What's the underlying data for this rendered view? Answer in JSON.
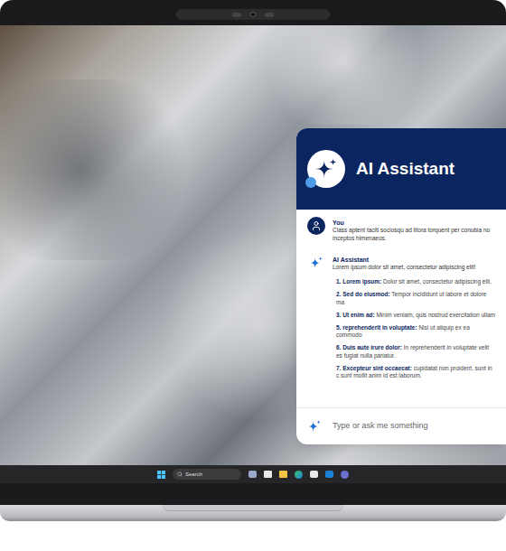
{
  "assistant": {
    "title": "AI Assistant",
    "input_placeholder": "Type or ask me something"
  },
  "messages": [
    {
      "kind": "user",
      "author": "You",
      "text": "Class aptent taciti sociosqu ad litora torquent per conubia no inceptos himenaeos."
    },
    {
      "kind": "assistant",
      "author": "AI Assistant",
      "text": "Lorem ipsum dolor sit amet, consectetur adipiscing elit!",
      "items": [
        {
          "number": "1.",
          "term": "Lorem ipsum:",
          "text": "Dolor sit amet, consectetur adipiscing elit."
        },
        {
          "number": "2.",
          "term": "Sed do eiusmod:",
          "text": "Tempor incididunt ut labore et dolore ma"
        },
        {
          "number": "3.",
          "term": "Ut enim ad:",
          "text": "Minim veniam, quis nostrud exercitation ullam"
        },
        {
          "number": "5.",
          "term": "reprehenderit in voluptate:",
          "text": "Nisi ut aliquip ex ea commodo"
        },
        {
          "number": "6.",
          "term": "Duis aute irure dolor:",
          "text": "In reprehenderit in voluptate velit es fugiat nulla pariatur."
        },
        {
          "number": "7.",
          "term": "Excepteur sint occaecat:",
          "text": "cupidatat non proident, sunt in c sunt mollit anim id est laborum."
        }
      ]
    }
  ],
  "taskbar": {
    "search_placeholder": "Search"
  }
}
